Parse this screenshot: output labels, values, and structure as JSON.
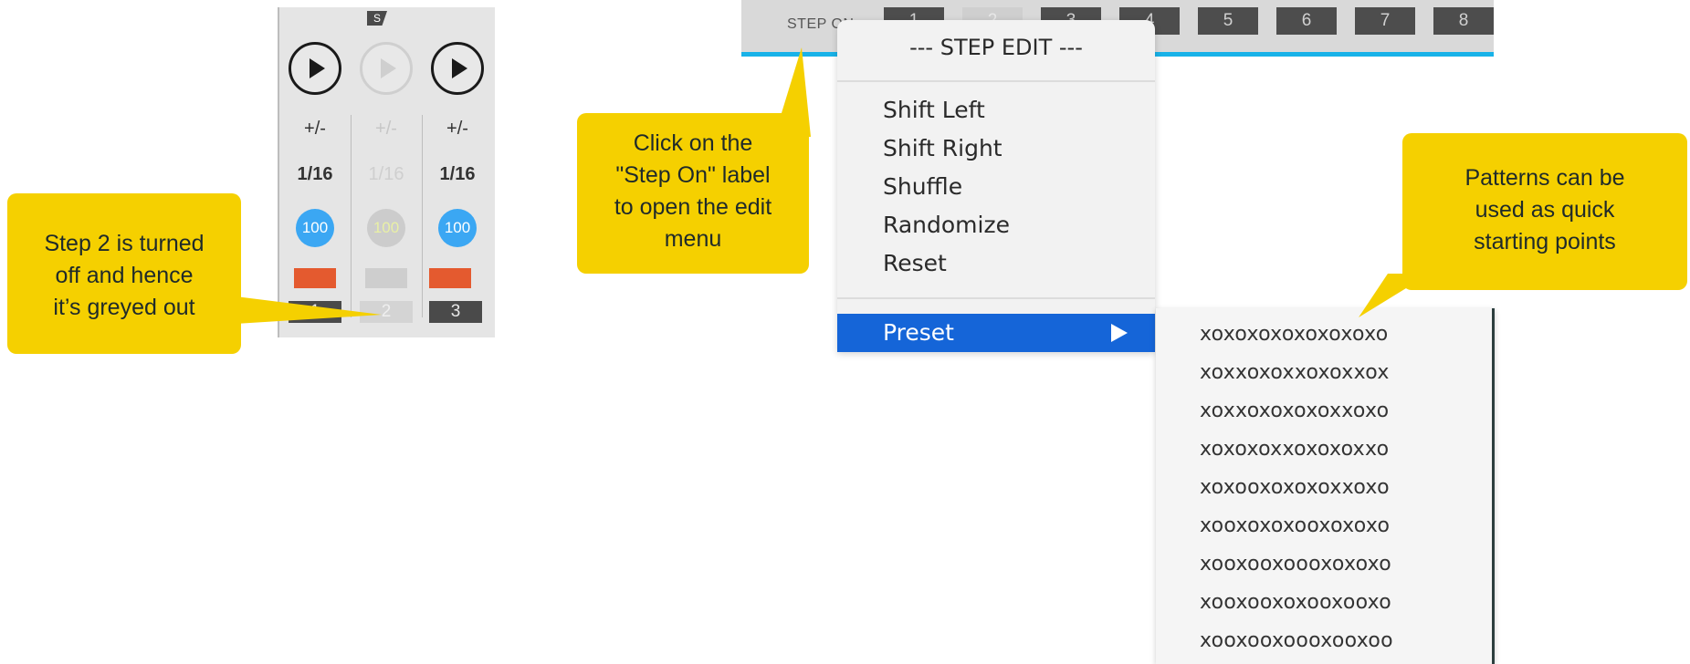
{
  "step_strip": {
    "badge": "S",
    "columns": [
      {
        "state": "on",
        "plus_minus": "+/-",
        "division": "1/16",
        "velocity": "100",
        "step_number": "1"
      },
      {
        "state": "off",
        "plus_minus": "+/-",
        "division": "1/16",
        "velocity": "100",
        "step_number": "2"
      },
      {
        "state": "on",
        "plus_minus": "+/-",
        "division": "1/16",
        "velocity": "100",
        "step_number": "3"
      }
    ]
  },
  "step_bar": {
    "label": "STEP ON",
    "steps": [
      {
        "number": "1",
        "state": "on"
      },
      {
        "number": "2",
        "state": "off"
      },
      {
        "number": "3",
        "state": "on"
      },
      {
        "number": "4",
        "state": "on"
      },
      {
        "number": "5",
        "state": "on"
      },
      {
        "number": "6",
        "state": "on"
      },
      {
        "number": "7",
        "state": "on"
      },
      {
        "number": "8",
        "state": "on"
      }
    ]
  },
  "menu": {
    "title": "--- STEP EDIT ---",
    "items": [
      "Shift Left",
      "Shift Right",
      "Shuffle",
      "Randomize",
      "Reset"
    ],
    "preset_label": "Preset"
  },
  "submenu": {
    "patterns": [
      "xoxoxoxoxoxoxoxo",
      "xoxxoxoxxoxoxxox",
      "xoxxoxoxoxoxxoxo",
      "xoxoxoxxoxoxoxxo",
      "xoxooxoxoxoxxoxo",
      "xooxoxoxooxoxoxo",
      "xooxooxoooxoxoxo",
      "xooxooxoxooxooxo",
      "xooxooxoooxooxoo"
    ]
  },
  "callouts": {
    "step2": "Step 2 is turned\noff and hence\nit’s greyed out",
    "stepon": "Click on the\n\"Step On\" label\nto open the edit\nmenu",
    "patterns": "Patterns can be\nused as quick\nstarting points"
  },
  "colors": {
    "accent_blue": "#3ba7f3",
    "gate_orange": "#e45a2f",
    "menu_highlight": "#1565d8",
    "callout_yellow": "#f5d000",
    "bar_underline": "#18b2e8"
  }
}
